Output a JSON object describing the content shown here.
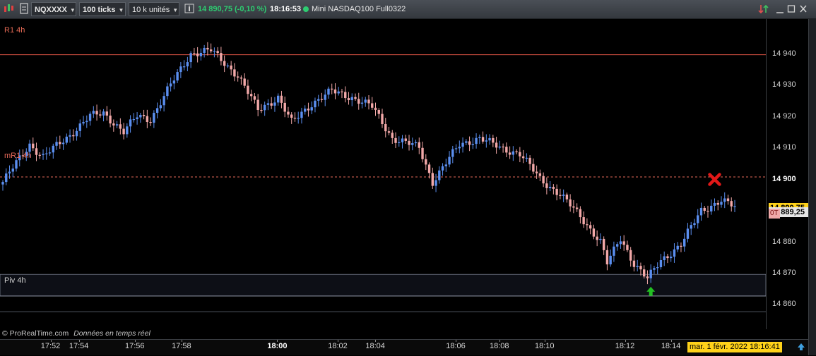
{
  "toolbar": {
    "symbol": "NQXXXX",
    "interval": "100 ticks",
    "units": "10 k unités",
    "last_price_change": "14 890,75 (-0,10 %)",
    "time": "18:16:53",
    "instrument": "Mini NASDAQ100 Full0322",
    "price_color": "#2ecc71"
  },
  "levels": {
    "r1_label": "R1 4h",
    "mr1_label": "mR1 4h",
    "piv_label": "Piv 4h"
  },
  "price_tags": {
    "last": "14 890,75",
    "bid": "14 889,25",
    "ot": "0T"
  },
  "footer": {
    "brand": "© ProRealTime.com",
    "realtime": "Données en temps réel",
    "datetime": "mar. 1 févr. 2022 18:16:41"
  },
  "colors": {
    "up": "#5b8ff0",
    "down": "#f2a8a8",
    "r1": "#e05545",
    "mr1": "#e86a5a",
    "piv": "#8a90a0",
    "last_tag": "#ffd21a",
    "bid_tag": "#e6e6e6"
  },
  "icons": [
    "chart-icon",
    "instrument-icon",
    "info-icon",
    "status-dot-icon",
    "arrows-icon",
    "minimize-icon",
    "maximize-icon",
    "close-icon",
    "sell-marker-icon",
    "buy-marker-icon",
    "expand-icon"
  ],
  "chart_data": {
    "type": "candlestick",
    "title": "Mini NASDAQ100 Full0322",
    "ylim": [
      14852,
      14951
    ],
    "y_ticks": [
      {
        "value": 14940,
        "label": "14 940"
      },
      {
        "value": 14930,
        "label": "14 930"
      },
      {
        "value": 14920,
        "label": "14 920"
      },
      {
        "value": 14910,
        "label": "14 910"
      },
      {
        "value": 14900,
        "label": "14 900",
        "bold": true
      },
      {
        "value": 14880,
        "label": "14 880"
      },
      {
        "value": 14870,
        "label": "14 870"
      },
      {
        "value": 14860,
        "label": "14 860"
      }
    ],
    "x_ticks": [
      {
        "label": "17:52",
        "pos": 0.066
      },
      {
        "label": "17:54",
        "pos": 0.103
      },
      {
        "label": "17:56",
        "pos": 0.176
      },
      {
        "label": "17:58",
        "pos": 0.237
      },
      {
        "label": "18:00",
        "pos": 0.362,
        "bold": true
      },
      {
        "label": "18:02",
        "pos": 0.441
      },
      {
        "label": "18:04",
        "pos": 0.49
      },
      {
        "label": "18:06",
        "pos": 0.595
      },
      {
        "label": "18:08",
        "pos": 0.652
      },
      {
        "label": "18:10",
        "pos": 0.711
      },
      {
        "label": "18:12",
        "pos": 0.816
      },
      {
        "label": "18:14",
        "pos": 0.876
      }
    ],
    "levels": [
      {
        "name": "R1 4h",
        "value": 14939.6
      },
      {
        "name": "mR1 4h",
        "value": 14900.6
      },
      {
        "name": "Piv 4h",
        "value": 14862.6
      }
    ],
    "markers": [
      {
        "type": "sell",
        "index": 212,
        "value": 14899.8
      },
      {
        "type": "buy",
        "index": 193,
        "value": 14864.2
      }
    ],
    "last_price": 14890.75,
    "bid_price": 14889.25,
    "close_path": [
      [
        0,
        14899
      ],
      [
        8,
        14911
      ],
      [
        12,
        14907
      ],
      [
        20,
        14914
      ],
      [
        26,
        14920
      ],
      [
        30,
        14921
      ],
      [
        36,
        14915
      ],
      [
        40,
        14920
      ],
      [
        44,
        14919
      ],
      [
        50,
        14930
      ],
      [
        56,
        14940
      ],
      [
        62,
        14941
      ],
      [
        70,
        14933
      ],
      [
        76,
        14922
      ],
      [
        82,
        14926
      ],
      [
        86,
        14918
      ],
      [
        92,
        14924
      ],
      [
        98,
        14928
      ],
      [
        104,
        14926
      ],
      [
        110,
        14923
      ],
      [
        116,
        14913
      ],
      [
        124,
        14910
      ],
      [
        128,
        14899
      ],
      [
        132,
        14905
      ],
      [
        136,
        14911
      ],
      [
        142,
        14913
      ],
      [
        148,
        14910
      ],
      [
        154,
        14908
      ],
      [
        160,
        14900
      ],
      [
        166,
        14895
      ],
      [
        172,
        14888
      ],
      [
        178,
        14880
      ],
      [
        180,
        14873
      ],
      [
        184,
        14881
      ],
      [
        188,
        14873
      ],
      [
        192,
        14868
      ],
      [
        196,
        14874
      ],
      [
        202,
        14879
      ],
      [
        208,
        14890
      ],
      [
        214,
        14893
      ],
      [
        218,
        14891
      ]
    ],
    "series_count": 219
  }
}
